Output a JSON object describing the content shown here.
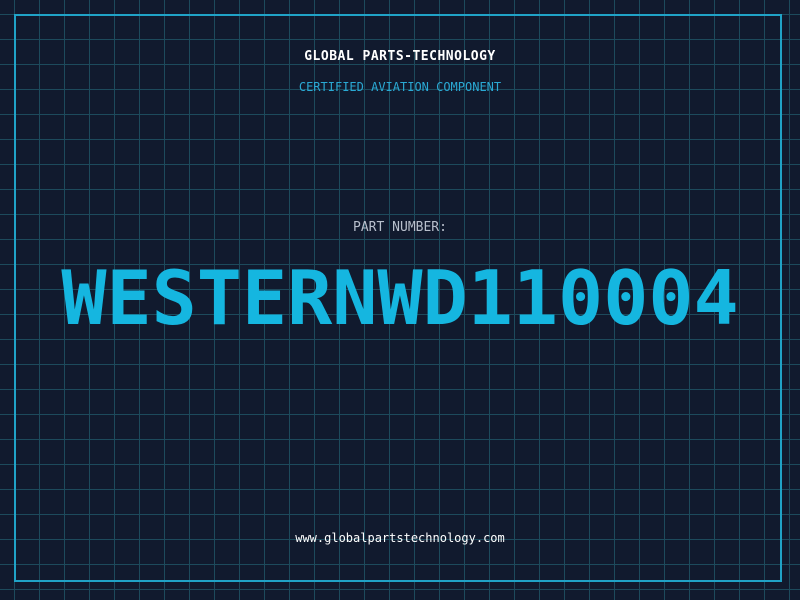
{
  "header": {
    "company": "GLOBAL PARTS-TECHNOLOGY",
    "subtitle": "CERTIFIED AVIATION COMPONENT"
  },
  "part": {
    "label": "PART NUMBER:",
    "number": "WESTERNWD110004"
  },
  "footer": {
    "website": "www.globalpartstechnology.com"
  },
  "colors": {
    "background": "#111a2e",
    "grid": "#1d4a5c",
    "accent": "#15b6e0",
    "frame": "#20a3c7"
  }
}
